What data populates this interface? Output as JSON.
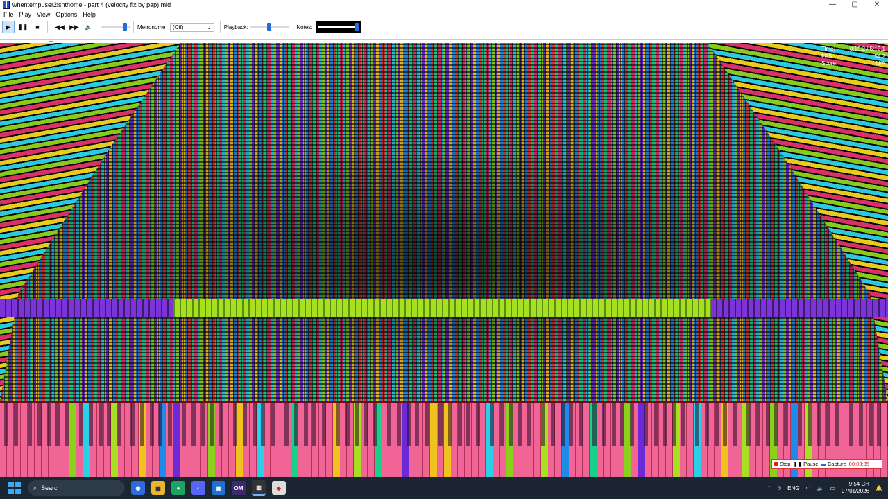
{
  "window": {
    "title": "whentempuser2isnthome - part 4 (velocity fix by pap).mid",
    "controls": [
      "—",
      "▢",
      "✕"
    ]
  },
  "menu": [
    "File",
    "Play",
    "View",
    "Options",
    "Help"
  ],
  "toolbar": {
    "metronome_label": "Metronome:",
    "metronome_value": "(Off)",
    "playback_label": "Playback:",
    "notes_label": "Notes:"
  },
  "stats": {
    "time_label": "Time:",
    "time_value": "0:19.2 / 5:12.1",
    "fps_label": "FPS:",
    "fps_value": "54.2",
    "score_label": "Score:",
    "score_value": "N/A"
  },
  "capture_bar": {
    "stop": "Stop",
    "pause": "Pause",
    "capture": "Capture",
    "timer": "00:03:35"
  },
  "taskbar": {
    "search_placeholder": "Search",
    "language": "ENG",
    "time": "9:54 CH",
    "date": "07/01/2026"
  }
}
